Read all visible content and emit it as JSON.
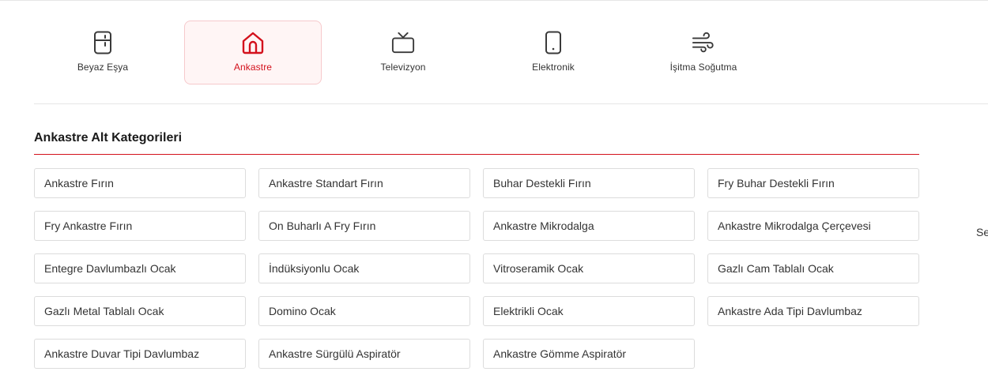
{
  "categories": [
    {
      "label": "Beyaz Eşya",
      "icon": "fridge-icon",
      "active": false
    },
    {
      "label": "Ankastre",
      "icon": "home-icon",
      "active": true
    },
    {
      "label": "Televizyon",
      "icon": "tv-icon",
      "active": false
    },
    {
      "label": "Elektronik",
      "icon": "phone-icon",
      "active": false
    },
    {
      "label": "İşitma Soğutma",
      "icon": "wind-icon",
      "active": false
    }
  ],
  "section": {
    "title": "Ankastre Alt Kategorileri",
    "items": [
      "Ankastre Fırın",
      "Ankastre Standart Fırın",
      "Buhar Destekli Fırın",
      "Fry Buhar Destekli Fırın",
      "Fry Ankastre Fırın",
      "On Buharlı A Fry Fırın",
      "Ankastre Mikrodalga",
      "Ankastre Mikrodalga Çerçevesi",
      "Entegre Davlumbazlı Ocak",
      "İndüksiyonlu Ocak",
      "Vitroseramik Ocak",
      "Gazlı Cam Tablalı Ocak",
      "Gazlı Metal Tablalı Ocak",
      "Domino Ocak",
      "Elektrikli Ocak",
      "Ankastre Ada Tipi Davlumbaz",
      "Ankastre Duvar Tipi Davlumbaz",
      "Ankastre Sürgülü Aspiratör",
      "Ankastre Gömme Aspiratör"
    ]
  },
  "side_text": "Se",
  "colors": {
    "accent": "#d3111c",
    "active_bg": "#fff5f5",
    "active_border": "#f6c9cc",
    "icon": "#3a3a3a"
  }
}
